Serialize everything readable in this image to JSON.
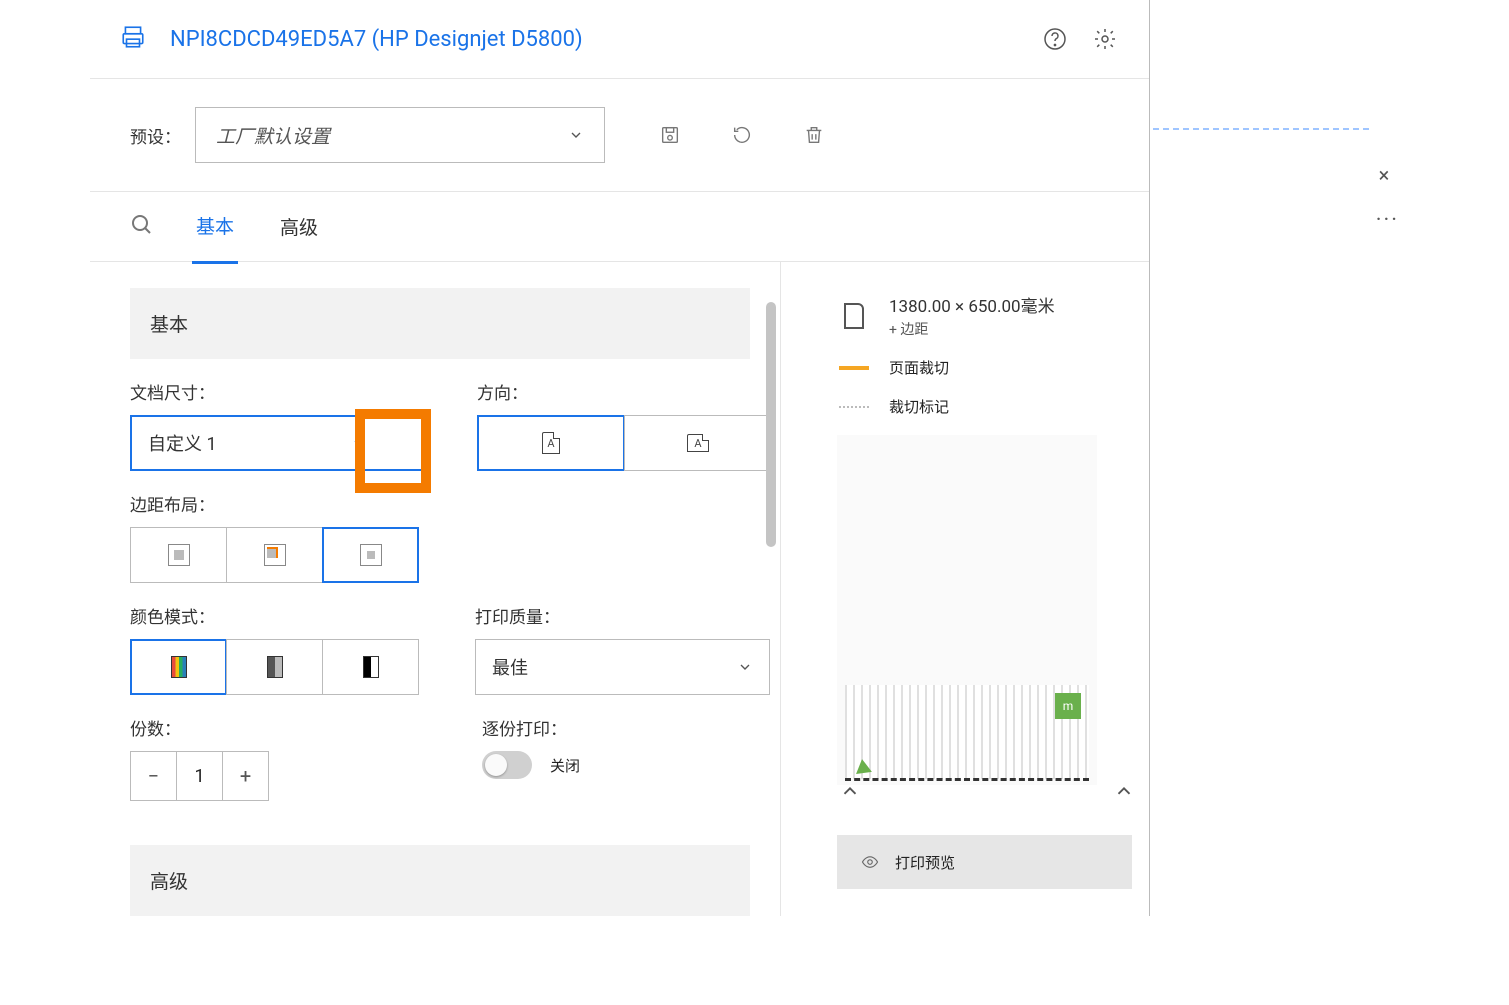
{
  "header": {
    "printer_name": "NPI8CDCD49ED5A7 (HP Designjet D5800)"
  },
  "preset": {
    "label": "预设：",
    "value": "工厂默认设置"
  },
  "tabs": {
    "basic": "基本",
    "advanced": "高级"
  },
  "section": {
    "basic_title": "基本",
    "advanced_title": "高级"
  },
  "fields": {
    "doc_size_label": "文档尺寸：",
    "doc_size_value": "自定义 1",
    "orientation_label": "方向：",
    "margin_layout_label": "边距布局：",
    "color_mode_label": "颜色模式：",
    "print_quality_label": "打印质量：",
    "print_quality_value": "最佳",
    "copies_label": "份数：",
    "copies_value": "1",
    "collate_label": "逐份打印：",
    "collate_value": "关闭"
  },
  "preview": {
    "dimensions": "1380.00 × 650.00毫米",
    "margins_note": "+ 边距",
    "page_clip": "页面裁切",
    "crop_marks": "裁切标记",
    "preview_button": "打印预览",
    "green_box_label": "m"
  }
}
